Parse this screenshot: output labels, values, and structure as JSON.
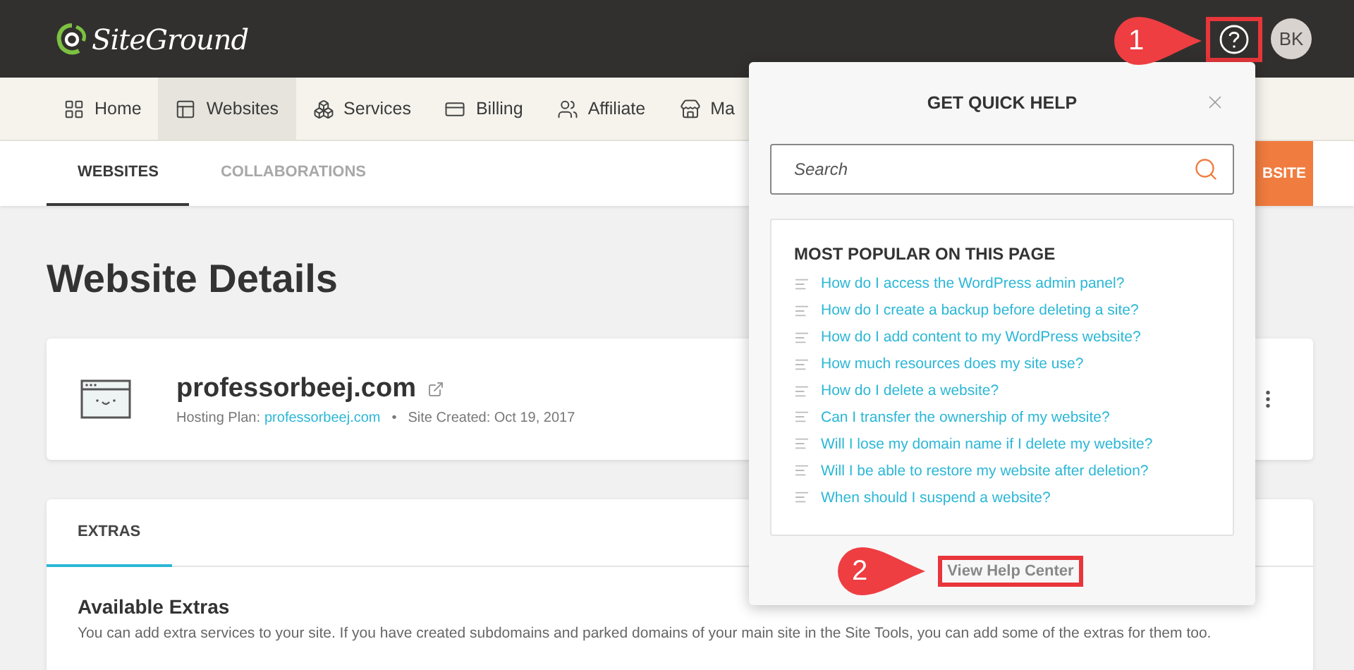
{
  "header": {
    "brand": "SiteGround",
    "help_button": {
      "highlighted": true
    },
    "avatar": "BK"
  },
  "nav": [
    {
      "label": "Home",
      "selected": false
    },
    {
      "label": "Websites",
      "selected": true
    },
    {
      "label": "Services",
      "selected": false
    },
    {
      "label": "Billing",
      "selected": false
    },
    {
      "label": "Affiliate",
      "selected": false
    },
    {
      "label": "Ma",
      "selected": false
    }
  ],
  "subtabs": [
    {
      "label": "WEBSITES",
      "selected": true
    },
    {
      "label": "COLLABORATIONS",
      "selected": false
    }
  ],
  "action_button": "BSITE",
  "page_title": "Website Details",
  "site_card": {
    "domain": "professorbeej.com",
    "plan_label": "Hosting Plan:",
    "plan_link": "professorbeej.com",
    "separator": "•",
    "created": "Site Created: Oct 19, 2017"
  },
  "extras": {
    "tabs": [
      {
        "label": "EXTRAS",
        "selected": true
      }
    ],
    "heading": "Available Extras",
    "text": "You can add extra services to your site. If you have created subdomains and parked domains of your main site in the Site Tools, you can add some of the extras for them too."
  },
  "quick_help": {
    "title": "GET QUICK HELP",
    "search": {
      "placeholder": "Search"
    },
    "section_title": "MOST POPULAR ON THIS PAGE",
    "articles": [
      "How do I access the WordPress admin panel?",
      "How do I create a backup before deleting a site?",
      "How do I add content to my WordPress website?",
      "How much resources does my site use?",
      "How do I delete a website?",
      "Can I transfer the ownership of my website?",
      "Will I lose my domain name if I delete my website?",
      "Will I be able to restore my website after deletion?",
      "When should I suspend a website?"
    ],
    "footer_link": {
      "label": "View Help Center",
      "highlighted": true
    }
  },
  "callouts": [
    "1",
    "2"
  ]
}
